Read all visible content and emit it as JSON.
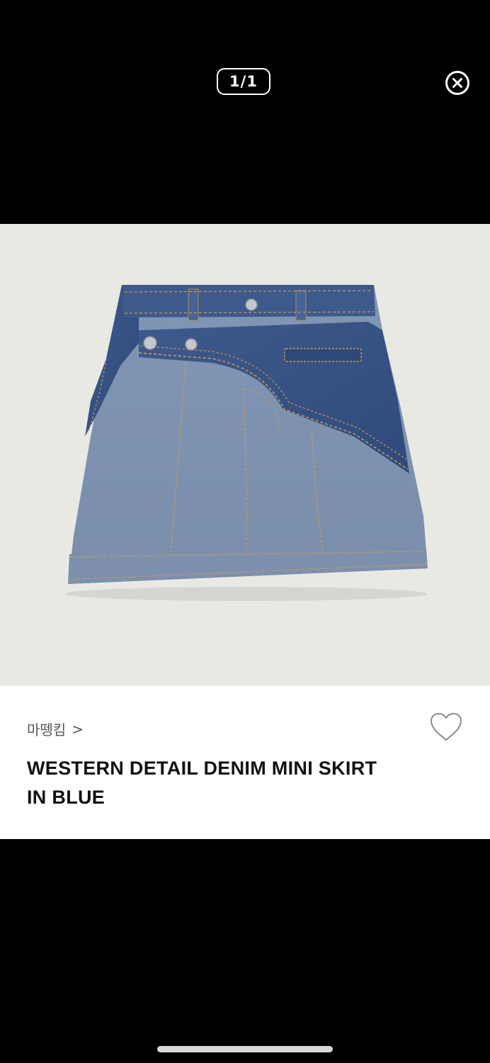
{
  "viewer": {
    "counter": "1/1"
  },
  "product": {
    "brand": "마뗑킴",
    "brand_chevron": ">",
    "title_line1": "WESTERN DETAIL DENIM MINI SKIRT",
    "title_line2": "IN BLUE"
  },
  "colors": {
    "background": "#000000",
    "image_background": "#e9e9e4",
    "card_background": "#ffffff",
    "title_text": "#111111",
    "brand_text": "#555555"
  },
  "icons": {
    "close": "close-circle-icon",
    "wishlist": "heart-outline-icon",
    "brand_link": "chevron-right-icon"
  }
}
